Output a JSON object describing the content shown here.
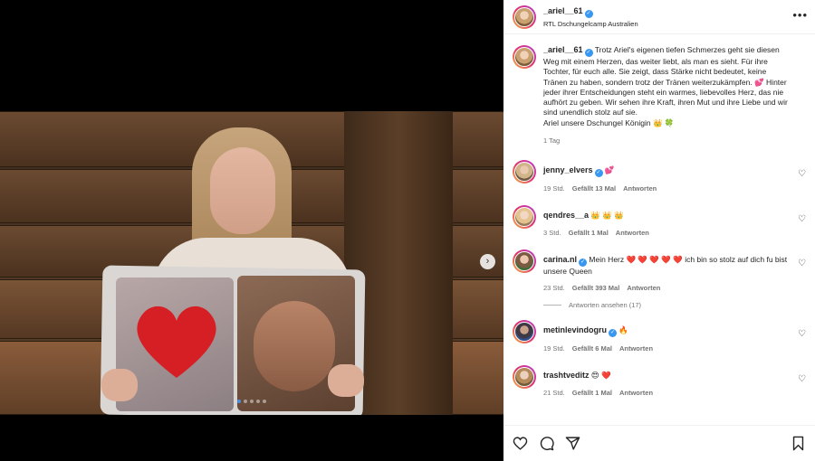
{
  "post": {
    "username": "_ariel__61",
    "location": "RTL Dschungelcamp Australien",
    "caption": "Trotz Ariel's eigenen tiefen Schmerzes geht sie diesen Weg mit einem Herzen, das weiter liebt, als man es sieht. Für ihre Tochter, für euch alle. Sie zeigt, dass Stärke nicht bedeutet, keine Tränen zu haben, sondern trotz der Tränen weiterzukämpfen. 💕 Hinter jeder ihrer Entscheidungen steht ein warmes, liebevolles Herz, das nie aufhört zu geben. Wir sehen ihre Kraft, ihren Mut und ihre Liebe und wir sind unendlich stolz auf sie.",
    "caption_line2": "Ariel unsere Dschungel Königin 👑 🍀",
    "time": "1 Tag",
    "more_icon": "more-horizontal-icon"
  },
  "comments": [
    {
      "username": "jenny_elvers",
      "verified": true,
      "text": "💕",
      "time": "19 Std.",
      "likes": "Gefällt 13 Mal",
      "reply": "Antworten"
    },
    {
      "username": "qendres__a",
      "verified": false,
      "text": "👑 👑 👑",
      "time": "3 Std.",
      "likes": "Gefällt 1 Mal",
      "reply": "Antworten"
    },
    {
      "username": "carina.nl",
      "verified": true,
      "text": "Mein Herz ❤️ ❤️ ❤️ ❤️ ❤️ ich bin so stolz auf dich fu bist unsere Queen",
      "time": "23 Std.",
      "likes": "Gefällt 393 Mal",
      "reply": "Antworten",
      "view_replies": "Antworten ansehen (17)"
    },
    {
      "username": "metinlevindogru",
      "verified": true,
      "text": "🔥",
      "time": "19 Std.",
      "likes": "Gefällt 6 Mal",
      "reply": "Antworten"
    },
    {
      "username": "trashtveditz",
      "verified": false,
      "text": "😍 ❤️",
      "time": "21 Std.",
      "likes": "Gefällt 1 Mal",
      "reply": "Antworten"
    }
  ],
  "carousel": {
    "slide_index": 1,
    "slide_count": 5
  },
  "colors": {
    "verified": "#3897f0",
    "heart": "#e0245e",
    "active_dot": "#4a90e2"
  }
}
